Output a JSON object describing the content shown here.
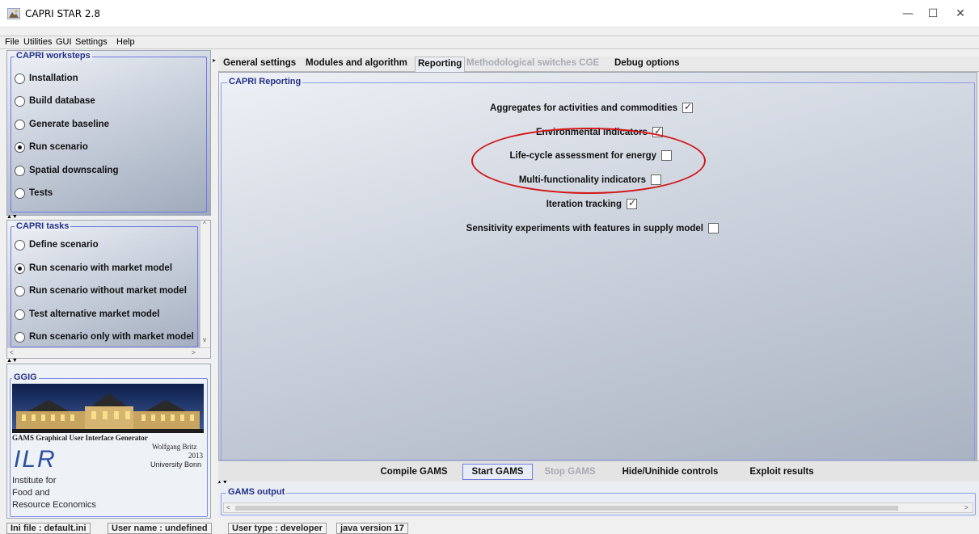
{
  "window": {
    "title": "CAPRI STAR 2.8",
    "controls": {
      "minimize": "—",
      "maximize": "☐",
      "close": "✕"
    }
  },
  "menu": [
    "File",
    "Utilities",
    "GUI",
    "Settings",
    "Help"
  ],
  "worksteps": {
    "title": "CAPRI worksteps",
    "items": [
      {
        "label": "Installation",
        "selected": false
      },
      {
        "label": "Build database",
        "selected": false
      },
      {
        "label": "Generate baseline",
        "selected": false
      },
      {
        "label": "Run scenario",
        "selected": true
      },
      {
        "label": "Spatial downscaling",
        "selected": false
      },
      {
        "label": "Tests",
        "selected": false
      }
    ]
  },
  "tasks": {
    "title": "CAPRI tasks",
    "items": [
      {
        "label": "Define scenario",
        "selected": false
      },
      {
        "label": "Run scenario with market model",
        "selected": true
      },
      {
        "label": "Run scenario without market model",
        "selected": false
      },
      {
        "label": "Test alternative market model",
        "selected": false
      },
      {
        "label": "Run scenario only with market model",
        "selected": false
      }
    ]
  },
  "ggig": {
    "title": "GGIG",
    "generator": "GAMS Graphical User Interface Generator",
    "author": "Wolfgang Britz",
    "year": "2013",
    "university": "University Bonn",
    "logo": "ILR",
    "institute": [
      "Institute  for",
      "Food and",
      "Resource Economics"
    ]
  },
  "tabs": [
    {
      "label": "General settings",
      "active": false,
      "enabled": true
    },
    {
      "label": "Modules and algorithm",
      "active": false,
      "enabled": true
    },
    {
      "label": "Reporting",
      "active": true,
      "enabled": true
    },
    {
      "label": "Methodological switches CGE",
      "active": false,
      "enabled": false
    },
    {
      "label": "Debug options",
      "active": false,
      "enabled": true
    }
  ],
  "reporting": {
    "title": "CAPRI Reporting",
    "options": [
      {
        "label": "Aggregates for activities and commodities",
        "checked": true
      },
      {
        "label": "Environmental Indicators",
        "checked": true
      },
      {
        "label": "Life-cycle assessment for energy",
        "checked": false
      },
      {
        "label": "Multi-functionality indicators",
        "checked": false
      },
      {
        "label": "Iteration tracking",
        "checked": true
      },
      {
        "label": "Sensitivity experiments with features in supply model",
        "checked": false
      }
    ]
  },
  "buttons": {
    "compile": "Compile GAMS",
    "start": "Start GAMS",
    "stop": "Stop GAMS",
    "hide": "Hide/Unihide controls",
    "exploit": "Exploit results"
  },
  "output": {
    "title": "GAMS output"
  },
  "status": {
    "ini": "Ini file : default.ini",
    "user": "User name : undefined",
    "type": "User type : developer",
    "java": "java version 17"
  },
  "colors": {
    "group_border": "#6d7be0",
    "annotation": "#d21818",
    "group_title": "#23328a"
  }
}
